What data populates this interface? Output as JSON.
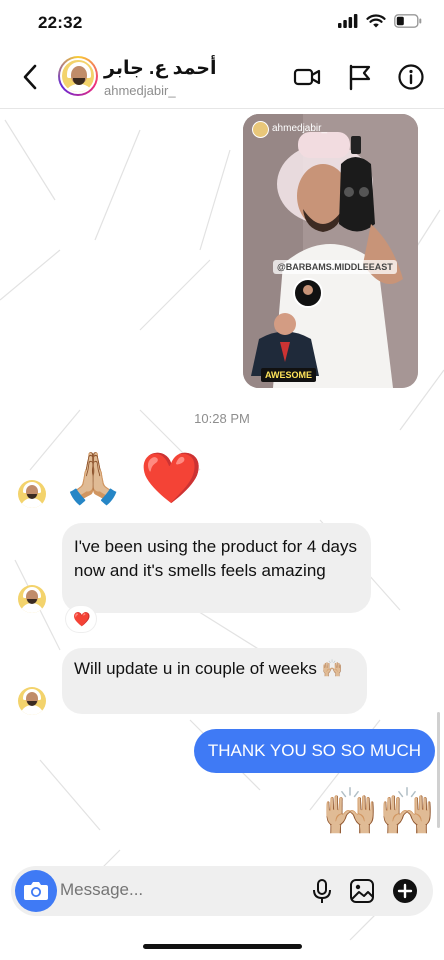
{
  "status": {
    "time": "22:32"
  },
  "header": {
    "name": "أحمد ع. جابر",
    "handle": "ahmedjabir_"
  },
  "story": {
    "handle": "ahmedjabir_",
    "tag": "@BARBAMS.MIDDLEEAST",
    "caption": "AWESOME"
  },
  "chat": {
    "timestamp": "10:28 PM",
    "messages": [
      {
        "from": "them",
        "text": "🙏🏼 ❤️"
      },
      {
        "from": "them",
        "text": "I've been using the product for 4 days now and it's smells feels amazing",
        "reaction": "❤️"
      },
      {
        "from": "them",
        "text": "Will update u in couple of weeks 🙌🏼"
      },
      {
        "from": "me",
        "text": "THANK YOU SO SO MUCH"
      },
      {
        "from": "me",
        "text": "🙌🏼🙌🏼"
      }
    ]
  },
  "composer": {
    "placeholder": "Message..."
  },
  "colors": {
    "accent": "#3f7af5",
    "bubble_in": "#efefef"
  },
  "icons": {
    "header": [
      "back-icon",
      "video-call-icon",
      "flag-icon",
      "info-icon"
    ],
    "composer": [
      "camera-icon",
      "microphone-icon",
      "gallery-icon",
      "plus-icon"
    ]
  }
}
